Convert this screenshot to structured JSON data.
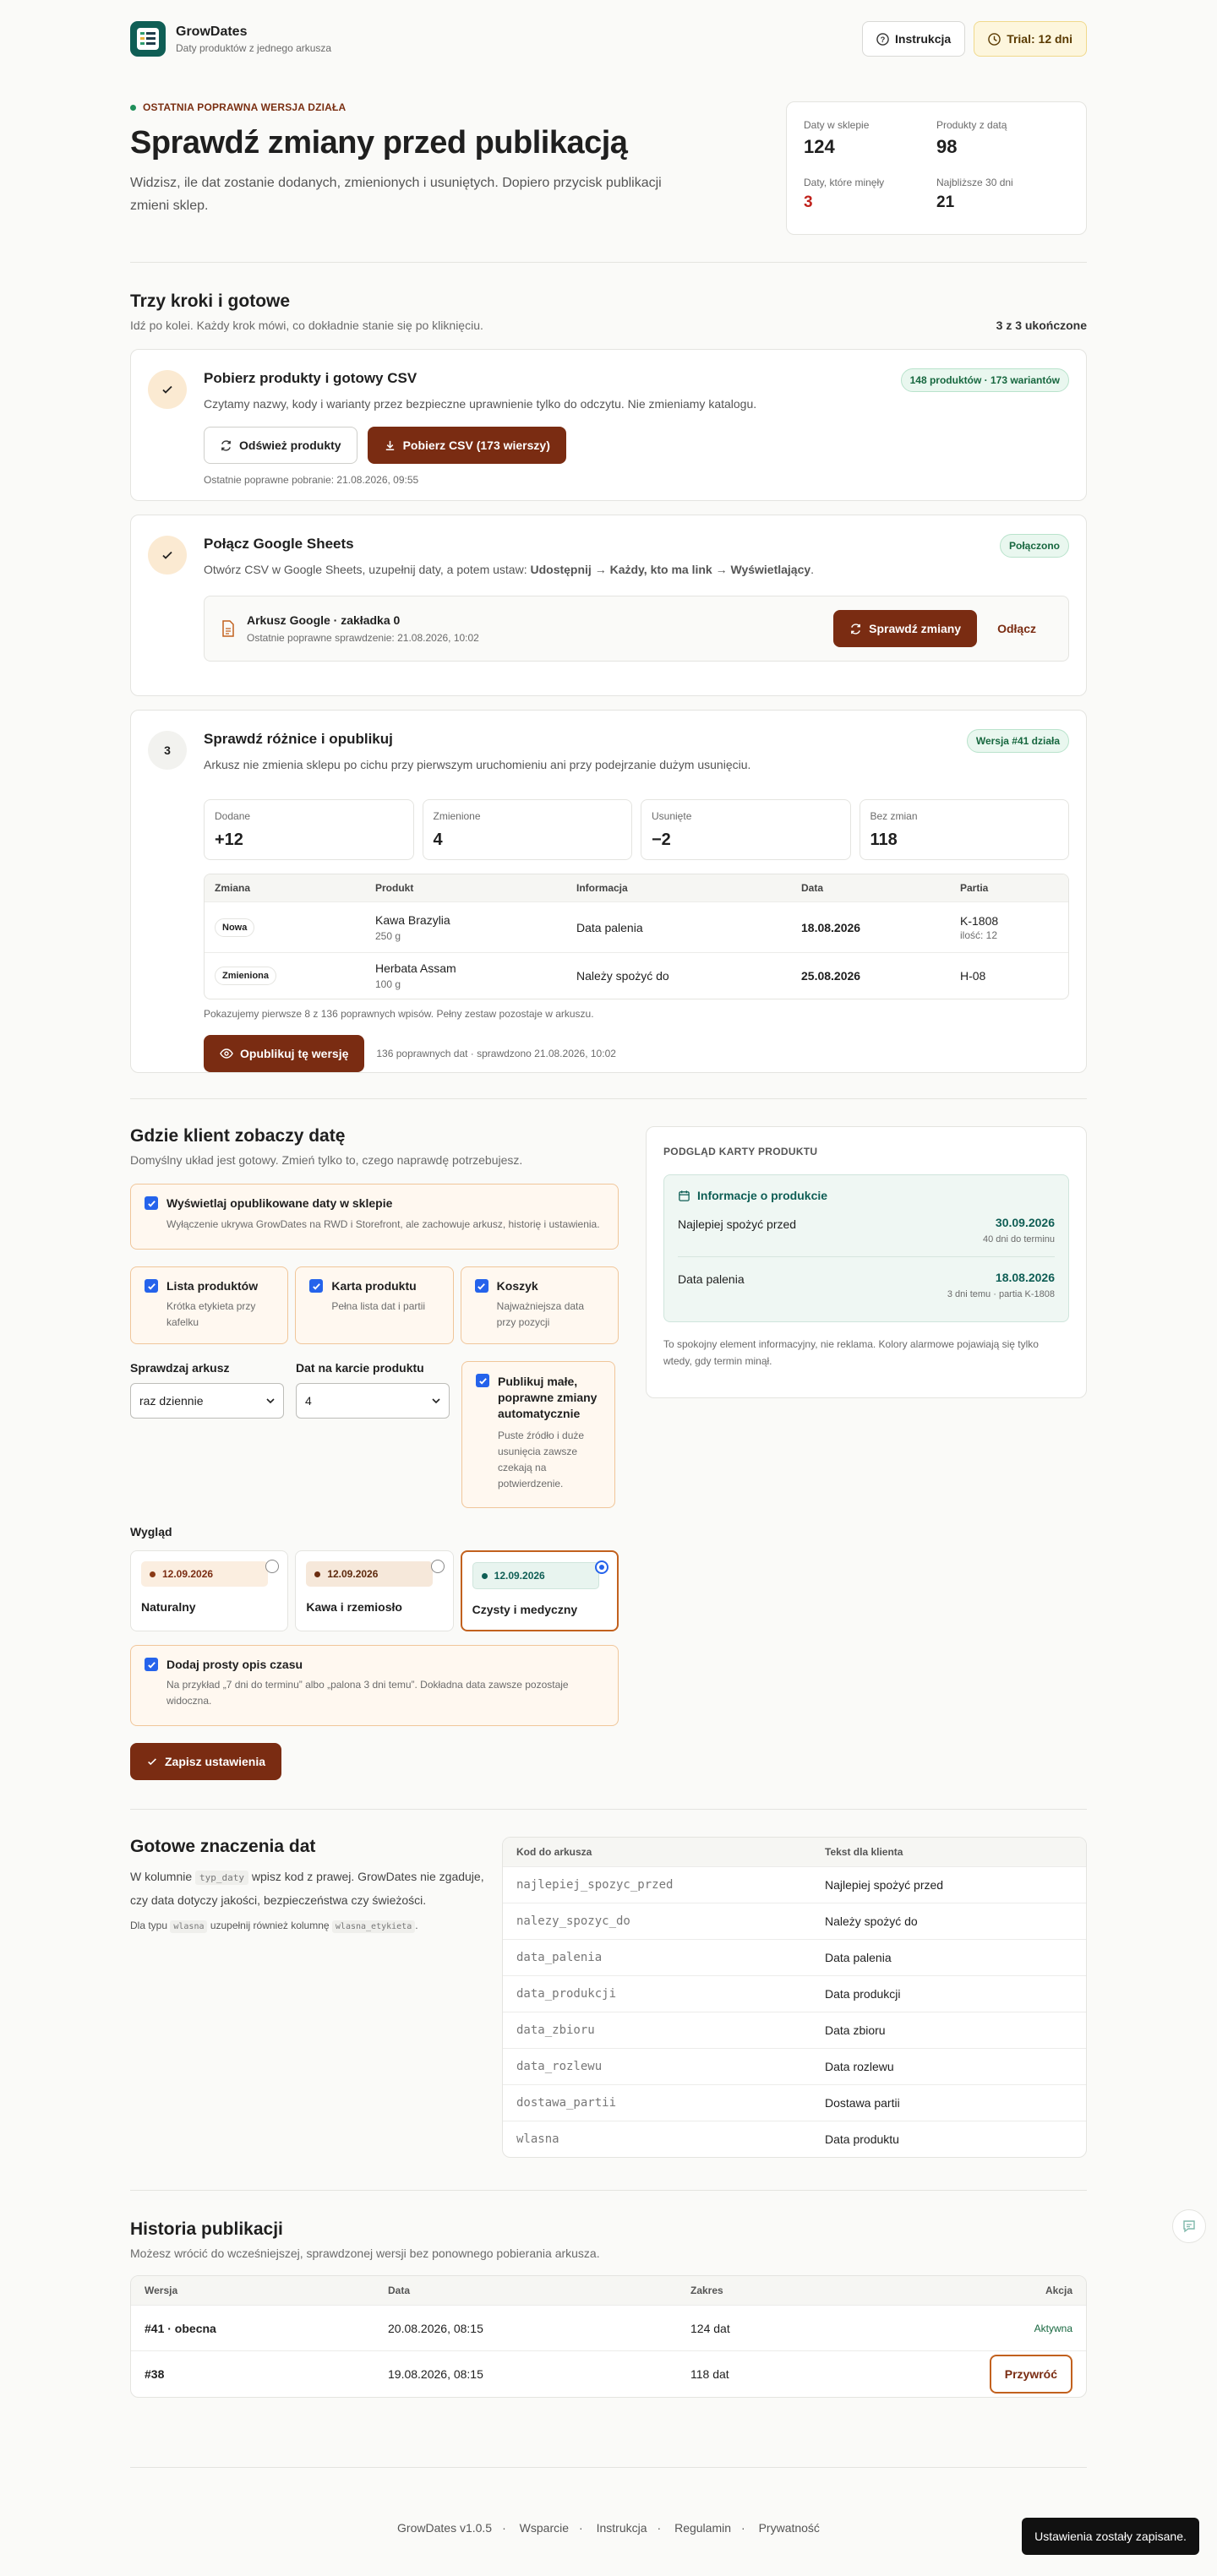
{
  "app": {
    "name": "GrowDates",
    "tagline": "Daty produktów z jednego arkusza"
  },
  "topbar": {
    "help": "Instrukcja",
    "trial": "Trial: 12 dni"
  },
  "hero": {
    "eyebrow": "OSTATNIA POPRAWNA WERSJA DZIAŁA",
    "title": "Sprawdź zmiany przed publikacją",
    "desc": "Widzisz, ile dat zostanie dodanych, zmienionych i usuniętych. Dopiero przycisk publikacji zmieni sklep."
  },
  "stats": [
    {
      "label": "Daty w sklepie",
      "value": "124"
    },
    {
      "label": "Produkty z datą",
      "value": "98"
    },
    {
      "label": "Daty, które minęły",
      "value": "3"
    },
    {
      "label": "Najbliższe 30 dni",
      "value": "21"
    }
  ],
  "steps_section": {
    "title": "Trzy kroki i gotowe",
    "sub": "Idź po kolei. Każdy krok mówi, co dokładnie stanie się po kliknięciu.",
    "progress": "3 z 3 ukończone"
  },
  "step1": {
    "title": "Pobierz produkty i gotowy CSV",
    "desc": "Czytamy nazwy, kody i warianty przez bezpieczne uprawnienie tylko do odczytu. Nie zmieniamy katalogu.",
    "badge": "148 produktów · 173 wariantów",
    "refresh": "Odśwież produkty",
    "download": "Pobierz CSV (173 wierszy)",
    "note": "Ostatnie poprawne pobranie: 21.08.2026, 09:55"
  },
  "step2": {
    "title": "Połącz Google Sheets",
    "desc_a": "Otwórz CSV w Google Sheets, uzupełnij daty, a potem ustaw: ",
    "desc_b": "Udostępnij → Każdy, kto ma link → Wyświetlający",
    "desc_c": ".",
    "badge": "Połączono",
    "sheet_title": "Arkusz Google · zakładka 0",
    "sheet_note": "Ostatnie poprawne sprawdzenie: 21.08.2026, 10:02",
    "check": "Sprawdź zmiany",
    "disconnect": "Odłącz"
  },
  "step3": {
    "num": "3",
    "title": "Sprawdź różnice i opublikuj",
    "desc": "Arkusz nie zmienia sklepu po cichu przy pierwszym uruchomieniu ani przy podejrzanie dużym usunięciu.",
    "badge": "Wersja #41 działa",
    "diffs": [
      {
        "label": "Dodane",
        "value": "+12"
      },
      {
        "label": "Zmienione",
        "value": "4"
      },
      {
        "label": "Usunięte",
        "value": "−2"
      },
      {
        "label": "Bez zmian",
        "value": "118"
      }
    ],
    "headers": [
      "Zmiana",
      "Produkt",
      "Informacja",
      "Data",
      "Partia"
    ],
    "rows": [
      {
        "change": "Nowa",
        "product": "Kawa Brazylia",
        "variant": "250 g",
        "info": "Data palenia",
        "date": "18.08.2026",
        "batch": "K-1808",
        "qty": "ilość: 12"
      },
      {
        "change": "Zmieniona",
        "product": "Herbata Assam",
        "variant": "100 g",
        "info": "Należy spożyć do",
        "date": "25.08.2026",
        "batch": "H-08",
        "qty": ""
      }
    ],
    "table_note": "Pokazujemy pierwsze 8 z 136 poprawnych wpisów. Pełny zestaw pozostaje w arkuszu.",
    "publish": "Opublikuj tę wersję",
    "publish_note": "136 poprawnych dat · sprawdzono 21.08.2026, 10:02"
  },
  "display": {
    "title": "Gdzie klient zobaczy datę",
    "sub": "Domyślny układ jest gotowy. Zmień tylko to, czego naprawdę potrzebujesz.",
    "show_title": "Wyświetlaj opublikowane daty w sklepie",
    "show_desc": "Wyłączenie ukrywa GrowDates na RWD i Storefront, ale zachowuje arkusz, historię i ustawienia.",
    "places": [
      {
        "title": "Lista produktów",
        "desc": "Krótka etykieta przy kafelku"
      },
      {
        "title": "Karta produktu",
        "desc": "Pełna lista dat i partii"
      },
      {
        "title": "Koszyk",
        "desc": "Najważniejsza data przy pozycji"
      }
    ],
    "check_label": "Sprawdzaj arkusz",
    "check_value": "raz dziennie",
    "count_label": "Dat na karcie produktu",
    "count_value": "4",
    "auto_title": "Publikuj małe, poprawne zmiany automatycznie",
    "auto_desc": "Puste źródło i duże usunięcia zawsze czekają na potwierdzenie.",
    "look_label": "Wygląd",
    "looks": [
      {
        "date": "12.09.2026",
        "name": "Naturalny"
      },
      {
        "date": "12.09.2026",
        "name": "Kawa i rzemiosło"
      },
      {
        "date": "12.09.2026",
        "name": "Czysty i medyczny"
      }
    ],
    "simple_title": "Dodaj prosty opis czasu",
    "simple_desc": "Na przykład „7 dni do terminu” albo „palona 3 dni temu”. Dokładna data zawsze pozostaje widoczna.",
    "save": "Zapisz ustawienia"
  },
  "preview": {
    "head": "PODGLĄD KARTY PRODUKTU",
    "box_title": "Informacje o produkcie",
    "rows": [
      {
        "label": "Najlepiej spożyć przed",
        "date": "30.09.2026",
        "note": "40 dni do terminu"
      },
      {
        "label": "Data palenia",
        "date": "18.08.2026",
        "note": "3 dni temu · partia K-1808"
      }
    ],
    "note": "To spokojny element informacyjny, nie reklama. Kolory alarmowe pojawiają się tylko wtedy, gdy termin minął."
  },
  "meanings": {
    "title": "Gotowe znaczenia dat",
    "desc_a": "W kolumnie ",
    "code": "typ_daty",
    "desc_b": " wpisz kod z prawej. GrowDates nie zgaduje, czy data dotyczy jakości, bezpieczeństwa czy świeżości.",
    "note_a": "Dla typu ",
    "note_code1": "wlasna",
    "note_b": " uzupełnij również kolumnę ",
    "note_code2": "wlasna_etykieta",
    "note_c": ".",
    "headers": [
      "Kod do arkusza",
      "Tekst dla klienta"
    ],
    "rows": [
      {
        "code": "najlepiej_spozyc_przed",
        "text": "Najlepiej spożyć przed"
      },
      {
        "code": "nalezy_spozyc_do",
        "text": "Należy spożyć do"
      },
      {
        "code": "data_palenia",
        "text": "Data palenia"
      },
      {
        "code": "data_produkcji",
        "text": "Data produkcji"
      },
      {
        "code": "data_zbioru",
        "text": "Data zbioru"
      },
      {
        "code": "data_rozlewu",
        "text": "Data rozlewu"
      },
      {
        "code": "dostawa_partii",
        "text": "Dostawa partii"
      },
      {
        "code": "wlasna",
        "text": "Data produktu"
      }
    ]
  },
  "history": {
    "title": "Historia publikacji",
    "sub": "Możesz wrócić do wcześniejszej, sprawdzonej wersji bez ponownego pobierania arkusza.",
    "headers": [
      "Wersja",
      "Data",
      "Zakres",
      "Akcja"
    ],
    "rows": [
      {
        "version": "#41 · obecna",
        "date": "20.08.2026, 08:15",
        "range": "124 dat",
        "action": "Aktywna"
      },
      {
        "version": "#38",
        "date": "19.08.2026, 08:15",
        "range": "118 dat",
        "action": "Przywróć"
      }
    ]
  },
  "footer": {
    "version": "GrowDates v1.0.5",
    "support": "Wsparcie",
    "guide": "Instrukcja",
    "terms": "Regulamin",
    "privacy": "Prywatność",
    "sep": "·"
  },
  "toast": "Ustawienia zostały zapisane.",
  "colors": {
    "accent": "#7a2c12",
    "brand": "#0f5e55",
    "success": "#17673f",
    "danger": "#c0231d"
  }
}
